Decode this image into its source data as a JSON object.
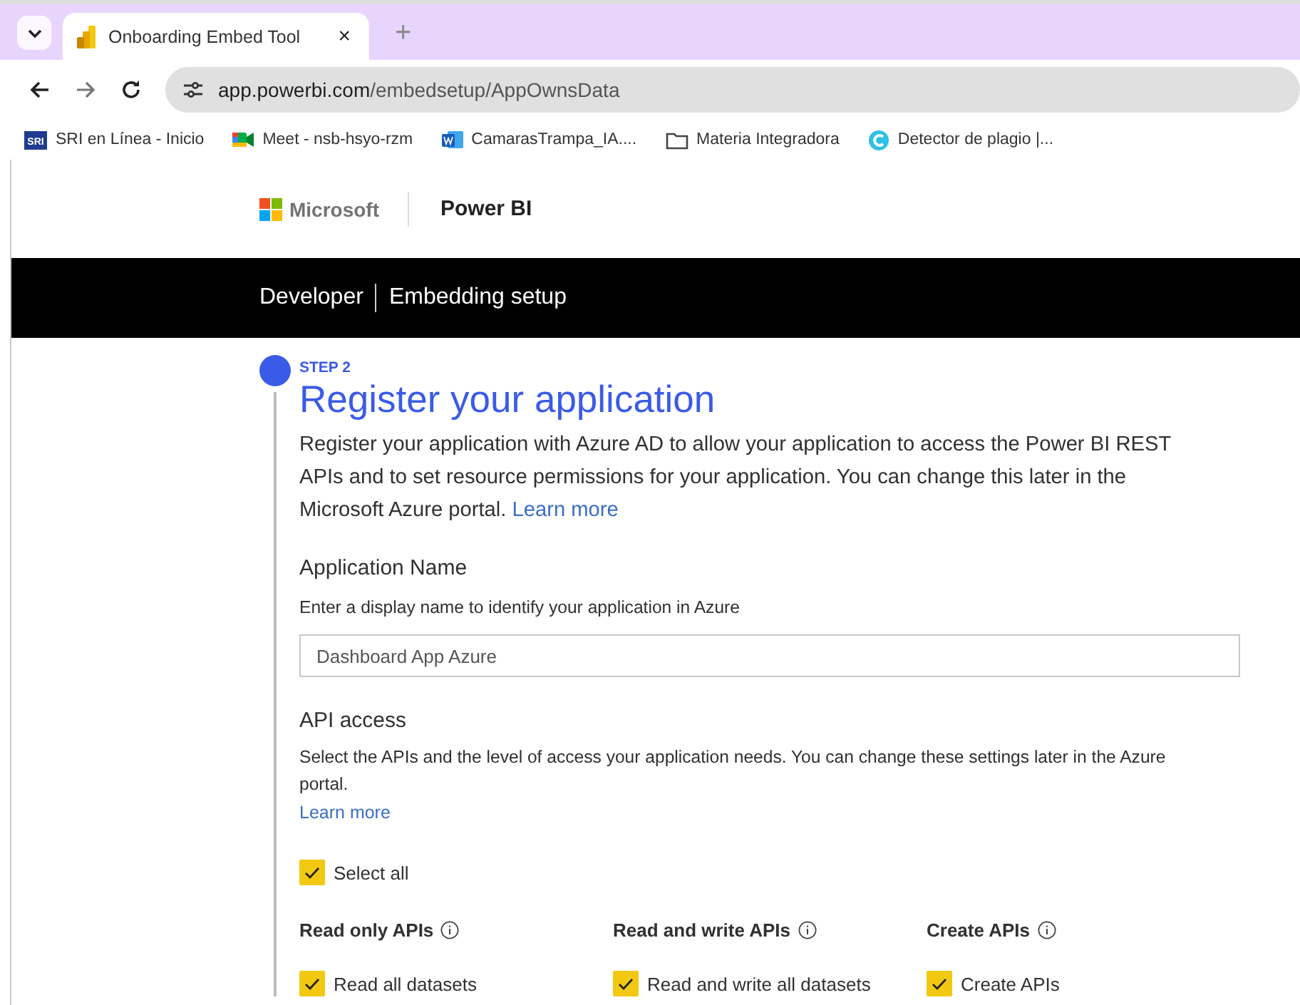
{
  "browser": {
    "tab": {
      "title": "Onboarding Embed Tool",
      "selected": true,
      "close": "×"
    },
    "new_tab": "+",
    "url": {
      "host": "app.powerbi.com",
      "path": "/embedsetup/AppOwnsData"
    },
    "bookmarks": [
      {
        "label": "SRI en Línea - Inicio",
        "kind": "sri",
        "badge": "SRI"
      },
      {
        "label": "Meet - nsb-hsyo-rzm",
        "kind": "meet"
      },
      {
        "label": "CamarasTrampa_IA....",
        "kind": "word"
      },
      {
        "label": "Materia Integradora",
        "kind": "folder"
      },
      {
        "label": "Detector de plagio |...",
        "kind": "copyleaks"
      }
    ]
  },
  "header": {
    "brand": "Microsoft",
    "product": "Power BI"
  },
  "nav": {
    "items": [
      "Developer",
      "Embedding setup"
    ]
  },
  "step": {
    "label": "STEP 2",
    "title": "Register your application",
    "intro": "Register your application with Azure AD to allow your application to access the Power BI REST APIs and to set resource permissions for your application. You can change this later in the Microsoft Azure portal.",
    "intro_link": "Learn more",
    "app_name": {
      "label": "Application Name",
      "hint": "Enter a display name to identify your application in Azure",
      "value": "Dashboard App Azure"
    },
    "api_access": {
      "label": "API access",
      "hint": "Select the APIs and the level of access your application needs. You can change these settings later in the Azure portal.",
      "link": "Learn more",
      "select_all": {
        "label": "Select all",
        "checked": true
      },
      "groups": [
        {
          "title": "Read only APIs",
          "items": [
            {
              "label": "Read all datasets",
              "checked": true
            }
          ]
        },
        {
          "title": "Read and write APIs",
          "items": [
            {
              "label": "Read and write all datasets",
              "checked": true
            }
          ]
        },
        {
          "title": "Create APIs",
          "items": [
            {
              "label": "Create APIs",
              "checked": true
            }
          ]
        }
      ]
    }
  }
}
